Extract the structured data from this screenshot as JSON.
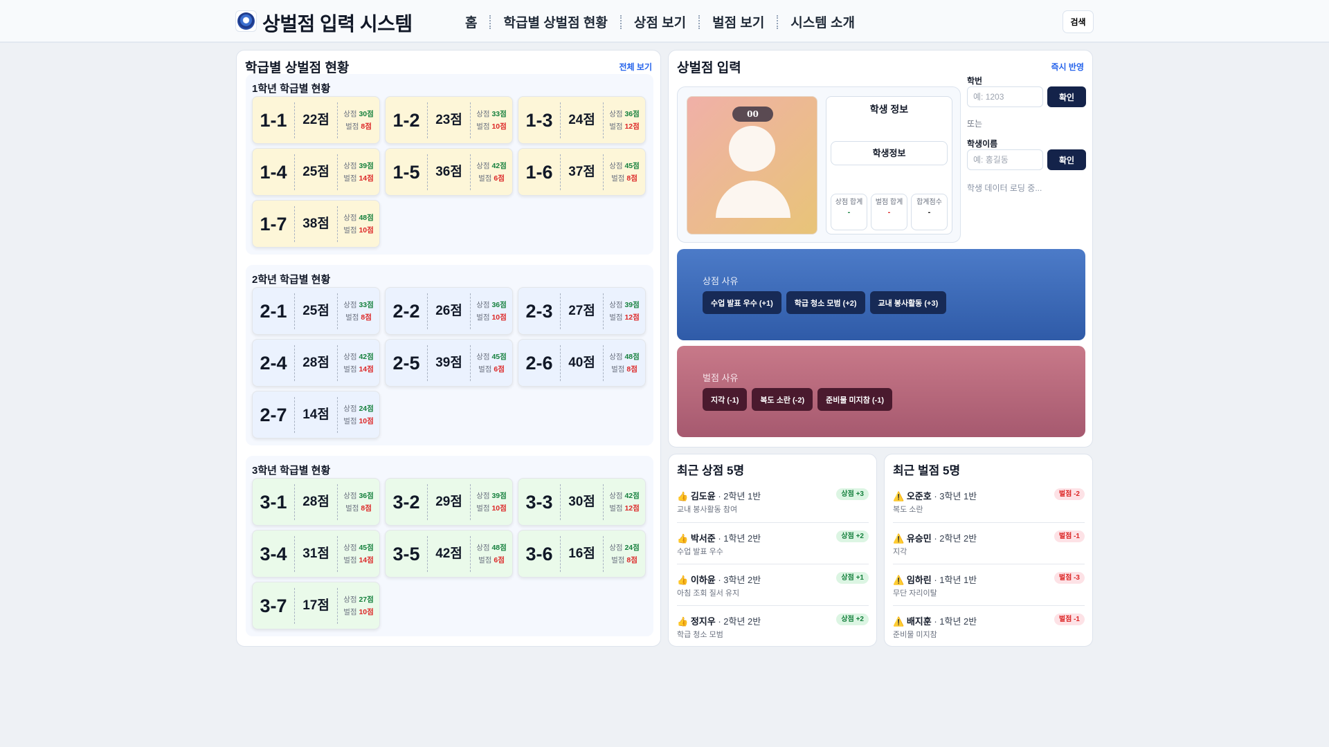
{
  "header": {
    "title": "상벌점 입력 시스템",
    "nav": [
      "홈",
      "학급별 상벌점 현황",
      "상점 보기",
      "벌점 보기",
      "시스템 소개"
    ],
    "search_label": "검색"
  },
  "overview": {
    "title": "학급별 상벌점 현황",
    "link": "전체 보기",
    "reward_label": "상점",
    "penalty_label": "벌점",
    "grades": [
      {
        "label": "1학년 학급별 현황",
        "classes": [
          {
            "name": "1-1",
            "total": "22점",
            "reward": "30점",
            "penalty": "8점"
          },
          {
            "name": "1-2",
            "total": "23점",
            "reward": "33점",
            "penalty": "10점"
          },
          {
            "name": "1-3",
            "total": "24점",
            "reward": "36점",
            "penalty": "12점"
          },
          {
            "name": "1-4",
            "total": "25점",
            "reward": "39점",
            "penalty": "14점"
          },
          {
            "name": "1-5",
            "total": "36점",
            "reward": "42점",
            "penalty": "6점"
          },
          {
            "name": "1-6",
            "total": "37점",
            "reward": "45점",
            "penalty": "8점"
          },
          {
            "name": "1-7",
            "total": "38점",
            "reward": "48점",
            "penalty": "10점"
          }
        ]
      },
      {
        "label": "2학년 학급별 현황",
        "classes": [
          {
            "name": "2-1",
            "total": "25점",
            "reward": "33점",
            "penalty": "8점"
          },
          {
            "name": "2-2",
            "total": "26점",
            "reward": "36점",
            "penalty": "10점"
          },
          {
            "name": "2-3",
            "total": "27점",
            "reward": "39점",
            "penalty": "12점"
          },
          {
            "name": "2-4",
            "total": "28점",
            "reward": "42점",
            "penalty": "14점"
          },
          {
            "name": "2-5",
            "total": "39점",
            "reward": "45점",
            "penalty": "6점"
          },
          {
            "name": "2-6",
            "total": "40점",
            "reward": "48점",
            "penalty": "8점"
          },
          {
            "name": "2-7",
            "total": "14점",
            "reward": "24점",
            "penalty": "10점"
          }
        ]
      },
      {
        "label": "3학년 학급별 현황",
        "classes": [
          {
            "name": "3-1",
            "total": "28점",
            "reward": "36점",
            "penalty": "8점"
          },
          {
            "name": "3-2",
            "total": "29점",
            "reward": "39점",
            "penalty": "10점"
          },
          {
            "name": "3-3",
            "total": "30점",
            "reward": "42점",
            "penalty": "12점"
          },
          {
            "name": "3-4",
            "total": "31점",
            "reward": "45점",
            "penalty": "14점"
          },
          {
            "name": "3-5",
            "total": "42점",
            "reward": "48점",
            "penalty": "6점"
          },
          {
            "name": "3-6",
            "total": "16점",
            "reward": "24점",
            "penalty": "8점"
          },
          {
            "name": "3-7",
            "total": "17점",
            "reward": "27점",
            "penalty": "10점"
          }
        ]
      }
    ]
  },
  "input": {
    "title": "상벌점 입력",
    "link": "즉시 반영",
    "photo_badge": "00",
    "info_title": "학생 정보",
    "info_button": "학생정보",
    "stats": [
      {
        "label": "상점 합계",
        "value": "-"
      },
      {
        "label": "벌점 합계",
        "value": "-"
      },
      {
        "label": "합계점수",
        "value": "-"
      }
    ],
    "id_label": "학번",
    "id_placeholder": "예: 1203",
    "confirm": "확인",
    "or": "또는",
    "name_label": "학생이름",
    "name_placeholder": "예: 홍길동",
    "loading": "학생 데이터 로딩 중...",
    "reward_title": "상점 사유",
    "reward_reasons": [
      "수업 발표 우수 (+1)",
      "학급 청소 모범 (+2)",
      "교내 봉사활동 (+3)"
    ],
    "penalty_title": "벌점 사유",
    "penalty_reasons": [
      "지각 (-1)",
      "복도 소란 (-2)",
      "준비물 미지참 (-1)"
    ]
  },
  "recent_rewards": {
    "title": "최근 상점 5명",
    "items": [
      {
        "name": "김도윤",
        "cls": " · 2학년 1반",
        "desc": "교내 봉사활동 참여",
        "badge": "상점 +3"
      },
      {
        "name": "박서준",
        "cls": " · 1학년 2반",
        "desc": "수업 발표 우수",
        "badge": "상점 +2"
      },
      {
        "name": "이하윤",
        "cls": " · 3학년 2반",
        "desc": "아침 조회 질서 유지",
        "badge": "상점 +1"
      },
      {
        "name": "정지우",
        "cls": " · 2학년 2반",
        "desc": "학급 청소 모범",
        "badge": "상점 +2"
      }
    ]
  },
  "recent_penalties": {
    "title": "최근 벌점 5명",
    "items": [
      {
        "name": "오준호",
        "cls": " · 3학년 1반",
        "desc": "복도 소란",
        "badge": "벌점 -2"
      },
      {
        "name": "유승민",
        "cls": " · 2학년 2반",
        "desc": "지각",
        "badge": "벌점 -1"
      },
      {
        "name": "임하린",
        "cls": " · 1학년 1반",
        "desc": "무단 자리이탈",
        "badge": "벌점 -3"
      },
      {
        "name": "배지훈",
        "cls": " · 1학년 2반",
        "desc": "준비물 미지참",
        "badge": "벌점 -1"
      }
    ]
  }
}
